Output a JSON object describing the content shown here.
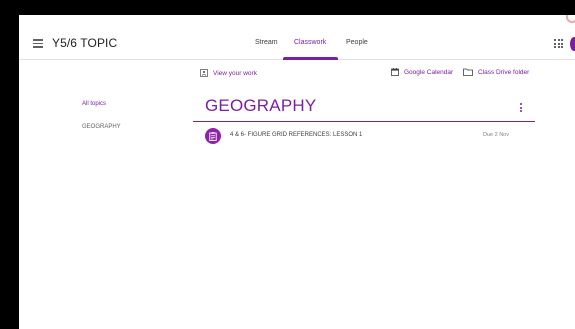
{
  "header": {
    "title": "Y5/6 TOPIC",
    "tabs": [
      {
        "label": "Stream"
      },
      {
        "label": "Classwork"
      },
      {
        "label": "People"
      }
    ]
  },
  "subbar": {
    "view_work": "View your work",
    "calendar": "Google Calendar",
    "drive": "Class Drive folder"
  },
  "sidebar": {
    "items": [
      {
        "label": "All topics"
      },
      {
        "label": "GEOGRAPHY"
      }
    ]
  },
  "topic": {
    "title": "GEOGRAPHY",
    "assignments": [
      {
        "title": "4 & 6- FIGURE GRID REFERENCES: LESSON 1",
        "due": "Due 2 Nov"
      }
    ]
  },
  "colors": {
    "accent": "#7b1fa2",
    "assignment_icon_bg": "#8e24aa"
  },
  "icons": {
    "menu": "hamburger-menu-icon",
    "apps": "apps-grid-icon",
    "view_work": "assignment-person-icon",
    "calendar": "calendar-icon",
    "drive": "folder-icon",
    "more": "more-vert-icon",
    "assignment": "assignment-icon"
  }
}
